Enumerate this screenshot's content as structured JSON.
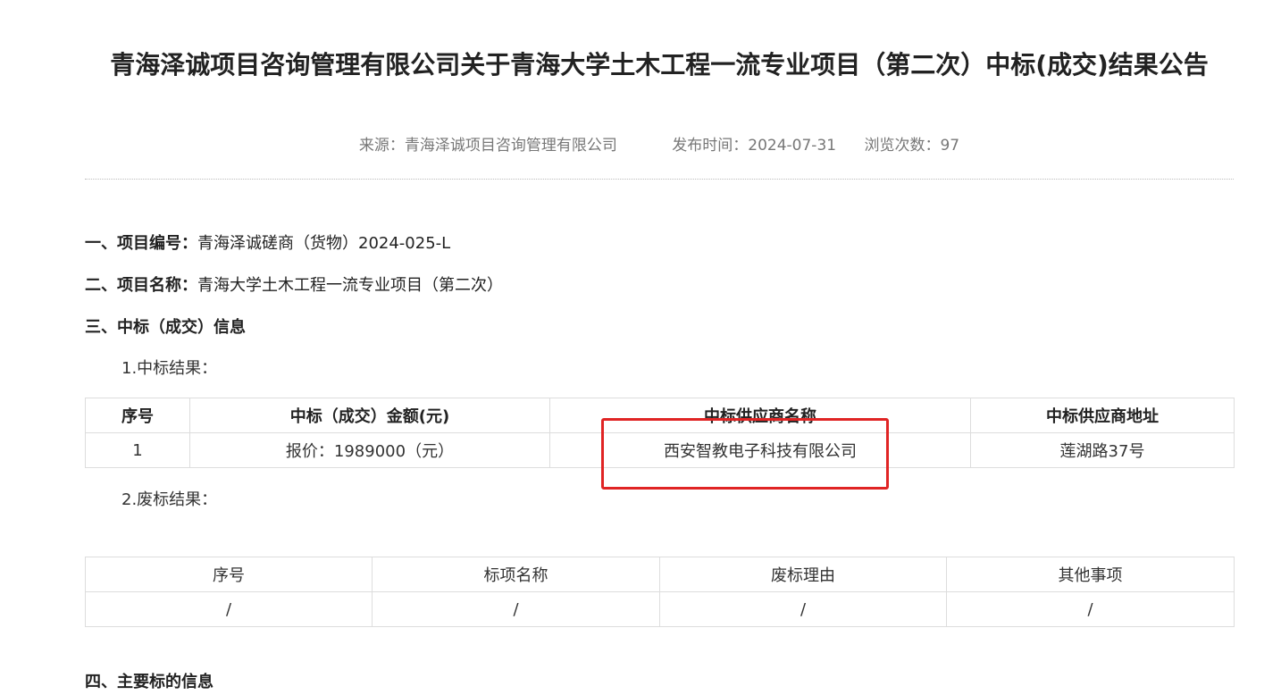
{
  "article": {
    "title": "青海泽诚项目咨询管理有限公司关于青海大学土木工程一流专业项目（第二次）中标(成交)结果公告",
    "source_label": "来源：",
    "source": "青海泽诚项目咨询管理有限公司",
    "date_label": "发布时间：",
    "date": "2024-07-31",
    "views_label": "浏览次数：",
    "views": "97"
  },
  "sections": {
    "project_no_label": "一、项目编号：",
    "project_no": "青海泽诚磋商（货物）2024-025-L",
    "project_name_label": "二、项目名称：",
    "project_name": "青海大学土木工程一流专业项目（第二次）",
    "award_info_heading": "三、中标（成交）信息",
    "award_result_label": "1.中标结果：",
    "failed_result_label": "2.废标结果：",
    "next_heading": "四、主要标的信息"
  },
  "win_table": {
    "headers": [
      "序号",
      "中标（成交）金额(元)",
      "中标供应商名称",
      "中标供应商地址"
    ],
    "rows": [
      [
        "1",
        "报价：1989000（元）",
        "西安智教电子科技有限公司",
        "莲湖路37号"
      ]
    ]
  },
  "fail_table": {
    "headers": [
      "序号",
      "标项名称",
      "废标理由",
      "其他事项"
    ],
    "rows": [
      [
        "/",
        "/",
        "/",
        "/"
      ]
    ]
  },
  "highlight_color": "#e02424"
}
